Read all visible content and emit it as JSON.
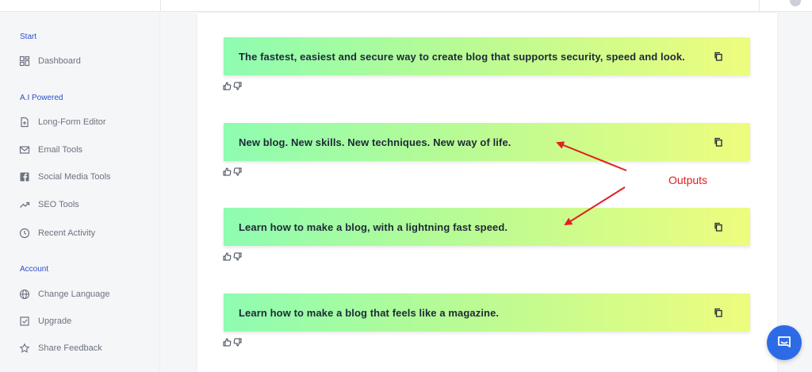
{
  "sidebar": {
    "sections": [
      {
        "label": "Start"
      },
      {
        "label": "A.I Powered"
      },
      {
        "label": "Account"
      }
    ],
    "items": [
      {
        "label": "Dashboard",
        "icon": "dashboard-icon"
      },
      {
        "label": "Long-Form Editor",
        "icon": "document-plus-icon"
      },
      {
        "label": "Email Tools",
        "icon": "envelope-icon"
      },
      {
        "label": "Social Media Tools",
        "icon": "facebook-icon"
      },
      {
        "label": "SEO Tools",
        "icon": "trending-up-icon"
      },
      {
        "label": "Recent Activity",
        "icon": "clock-icon"
      },
      {
        "label": "Change Language",
        "icon": "globe-icon"
      },
      {
        "label": "Upgrade",
        "icon": "checkbox-icon"
      },
      {
        "label": "Share Feedback",
        "icon": "star-icon"
      }
    ]
  },
  "results": [
    {
      "text": "The fastest, easiest and secure way to create blog that supports security, speed and look."
    },
    {
      "text": "New blog. New skills. New techniques. New way of life."
    },
    {
      "text": "Learn how to make a blog, with a lightning fast speed."
    },
    {
      "text": "Learn how to make a blog that feels like a magazine."
    }
  ],
  "annotation": {
    "label": "Outputs",
    "color": "#e0201f"
  },
  "colors": {
    "accent": "#2e4fc9",
    "gradient_start": "#8efcb1",
    "gradient_end": "#eefc7e",
    "chat_button": "#2d6be6"
  }
}
